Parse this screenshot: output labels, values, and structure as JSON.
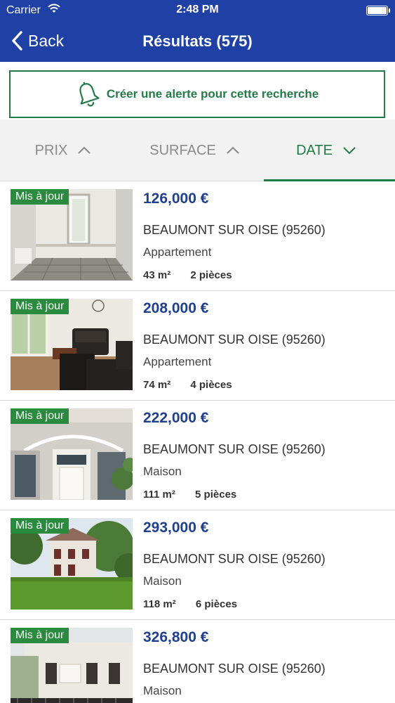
{
  "status_bar": {
    "carrier": "Carrier",
    "time": "2:48 PM"
  },
  "nav": {
    "back_label": "Back",
    "title": "Résultats (575)"
  },
  "alert": {
    "label": "Créer une alerte pour cette recherche"
  },
  "sort": {
    "tabs": [
      {
        "label": "PRIX",
        "arrow": "chevron-up-icon",
        "active": false
      },
      {
        "label": "SURFACE",
        "arrow": "chevron-up-icon",
        "active": false
      },
      {
        "label": "DATE",
        "arrow": "chevron-down-icon",
        "active": true
      }
    ]
  },
  "colors": {
    "nav_blue": "#1f40a4",
    "accent_green": "#237b47",
    "price_blue": "#1f3f8f",
    "badge_green": "#2a8a3d"
  },
  "listings": [
    {
      "badge": "Mis à jour",
      "price": "126,000 €",
      "city": "BEAUMONT SUR OISE (95260)",
      "type": "Appartement",
      "surface": "43 m²",
      "rooms": "2 pièces",
      "photo": "interior-empty-room"
    },
    {
      "badge": "Mis à jour",
      "price": "208,000 €",
      "city": "BEAUMONT SUR OISE (95260)",
      "type": "Appartement",
      "surface": "74 m²",
      "rooms": "4 pièces",
      "photo": "living-room"
    },
    {
      "badge": "Mis à jour",
      "price": "222,000 €",
      "city": "BEAUMONT SUR OISE (95260)",
      "type": "Maison",
      "surface": "111 m²",
      "rooms": "5 pièces",
      "photo": "house-entrance"
    },
    {
      "badge": "Mis à jour",
      "price": "293,000 €",
      "city": "BEAUMONT SUR OISE (95260)",
      "type": "Maison",
      "surface": "118 m²",
      "rooms": "6 pièces",
      "photo": "house-garden"
    },
    {
      "badge": "Mis à jour",
      "price": "326,800 €",
      "city": "BEAUMONT SUR OISE (95260)",
      "type": "Maison",
      "surface": "",
      "rooms": "",
      "photo": "house-facade"
    }
  ]
}
